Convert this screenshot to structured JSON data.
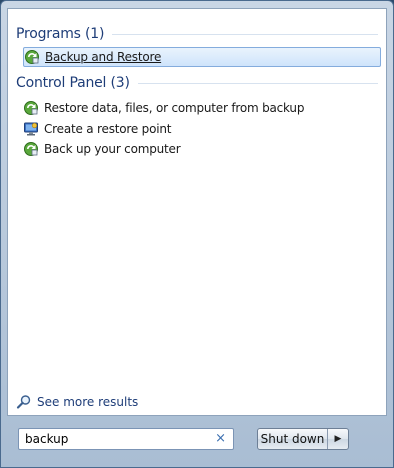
{
  "groups": [
    {
      "title": "Programs (1)"
    },
    {
      "title": "Control Panel (3)"
    }
  ],
  "programs": [
    {
      "label": "Backup and Restore",
      "icon": "backup-restore-icon",
      "selected": true
    }
  ],
  "control_panel": [
    {
      "label": "Restore data, files, or computer from backup",
      "icon": "backup-restore-icon"
    },
    {
      "label": "Create a restore point",
      "icon": "system-restore-icon"
    },
    {
      "label": "Back up your computer",
      "icon": "backup-restore-icon"
    }
  ],
  "see_more": {
    "label": "See more results",
    "icon": "search-icon"
  },
  "search": {
    "value": "backup",
    "clear_glyph": "×"
  },
  "shutdown": {
    "label": "Shut down",
    "arrow_glyph": "▶"
  },
  "colors": {
    "group_title": "#1e3d78",
    "selection_border": "#84acdd",
    "selection_fill": "#cfe4fb"
  }
}
